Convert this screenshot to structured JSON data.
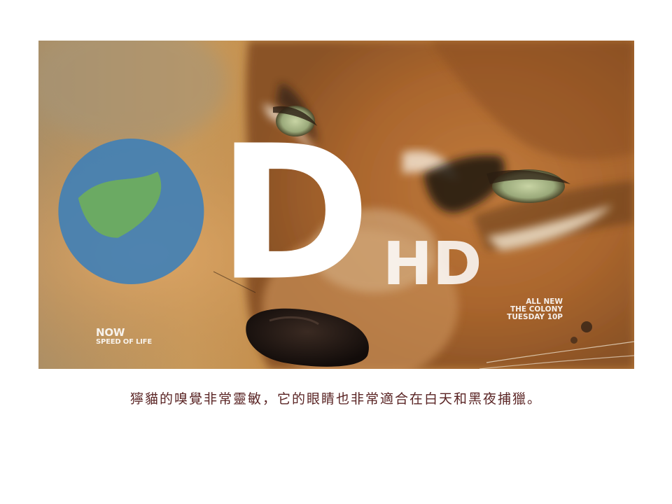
{
  "photo": {
    "subject": "close-up of a caracal face",
    "watermark_left_line1": "NOW",
    "watermark_left_line2": "SPEED OF LIFE",
    "promo_line1": "ALL NEW",
    "promo_line2": "THE COLONY",
    "promo_line3": "TUESDAY 10P",
    "network_logo": "D",
    "network_hd": "HD"
  },
  "caption": "獰貓的嗅覺非常靈敏，它的眼睛也非常適合在白天和黑夜捕獵。"
}
